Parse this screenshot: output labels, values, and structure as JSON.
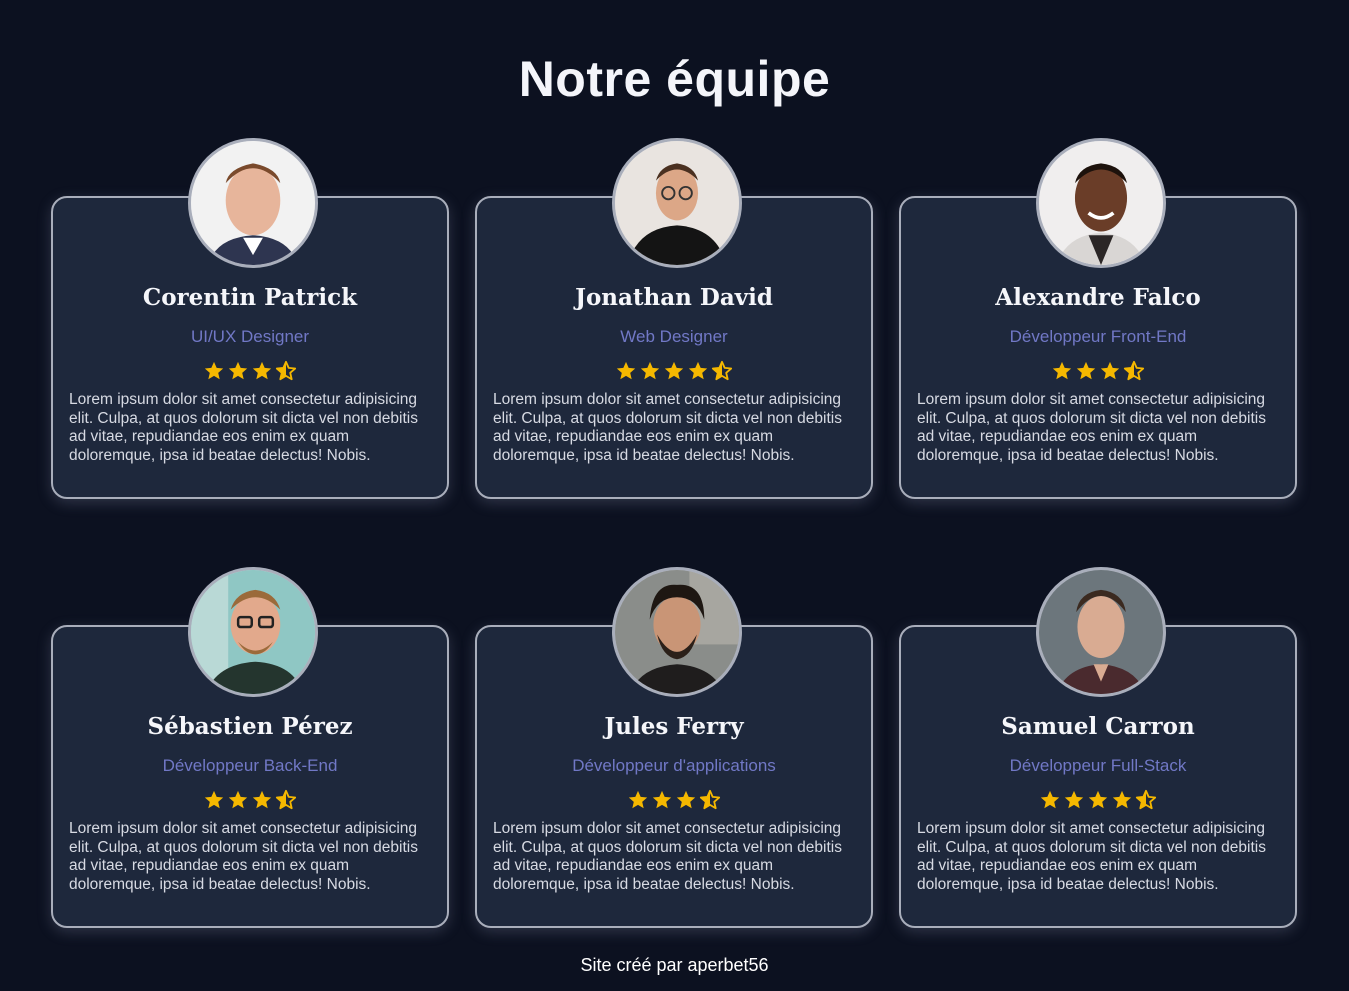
{
  "page": {
    "title": "Notre équipe",
    "footer": "Site créé par aperbet56"
  },
  "colors": {
    "background": "#0c1120",
    "card": "#1e283c",
    "role": "#7178c6",
    "star": "#f5b800",
    "border": "#a9aebb"
  },
  "team": [
    {
      "name": "Corentin Patrick",
      "role": "UI/UX Designer",
      "rating": 3.5,
      "description": "Lorem ipsum dolor sit amet consectetur adipisicing elit. Culpa, at quos dolorum sit dicta vel non debitis ad vitae, repudiandae eos enim ex quam doloremque, ipsa id beatae delectus! Nobis."
    },
    {
      "name": "Jonathan David",
      "role": "Web Designer",
      "rating": 4.5,
      "description": "Lorem ipsum dolor sit amet consectetur adipisicing elit. Culpa, at quos dolorum sit dicta vel non debitis ad vitae, repudiandae eos enim ex quam doloremque, ipsa id beatae delectus! Nobis."
    },
    {
      "name": "Alexandre Falco",
      "role": "Développeur Front-End",
      "rating": 3.5,
      "description": "Lorem ipsum dolor sit amet consectetur adipisicing elit. Culpa, at quos dolorum sit dicta vel non debitis ad vitae, repudiandae eos enim ex quam doloremque, ipsa id beatae delectus! Nobis."
    },
    {
      "name": "Sébastien Pérez",
      "role": "Développeur Back-End",
      "rating": 3.5,
      "description": "Lorem ipsum dolor sit amet consectetur adipisicing elit. Culpa, at quos dolorum sit dicta vel non debitis ad vitae, repudiandae eos enim ex quam doloremque, ipsa id beatae delectus! Nobis."
    },
    {
      "name": "Jules Ferry",
      "role": "Développeur d'applications",
      "rating": 3.5,
      "description": "Lorem ipsum dolor sit amet consectetur adipisicing elit. Culpa, at quos dolorum sit dicta vel non debitis ad vitae, repudiandae eos enim ex quam doloremque, ipsa id beatae delectus! Nobis."
    },
    {
      "name": "Samuel Carron",
      "role": "Développeur Full-Stack",
      "rating": 4.5,
      "description": "Lorem ipsum dolor sit amet consectetur adipisicing elit. Culpa, at quos dolorum sit dicta vel non debitis ad vitae, repudiandae eos enim ex quam doloremque, ipsa id beatae delectus! Nobis."
    }
  ]
}
